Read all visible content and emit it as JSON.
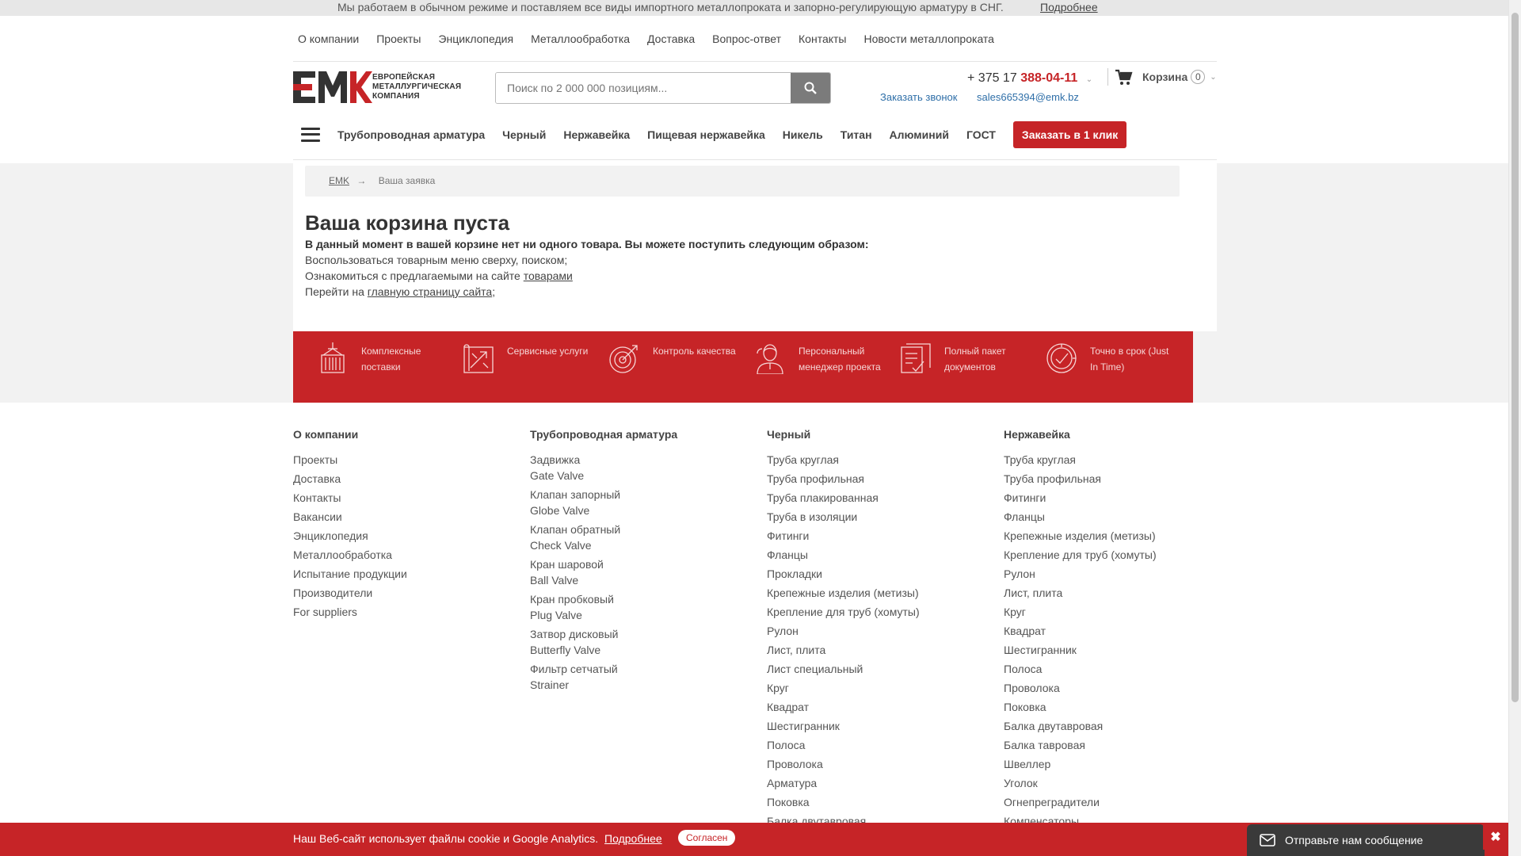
{
  "infobar": {
    "message": "Мы работаем в обычном режиме и поставляем все виды импортного металлопроката и запорно-регулирующую арматуру в СНГ.",
    "more": "Подробнее"
  },
  "topnav": [
    "О компании",
    "Проекты",
    "Энциклопедия",
    "Металлообработка",
    "Доставка",
    "Вопрос-ответ",
    "Контакты",
    "Новости металлопроката"
  ],
  "header": {
    "logo_text": "ЕВРОПЕЙСКАЯ МЕТАЛЛУРГИЧЕСКАЯ КОМПАНИЯ",
    "search_placeholder": "Поиск по 2 000 000 позициям...",
    "phone_prefix": "+ 375 17",
    "phone_main": "388-04-11",
    "callback": "Заказать звонок",
    "email": "sales665394@emk.bz",
    "cart_label": "Корзина",
    "cart_count": "0"
  },
  "catnav": {
    "items": [
      "Трубопроводная арматура",
      "Черный",
      "Нержавейка",
      "Пищевая нержавейка",
      "Никель",
      "Титан",
      "Алюминий",
      "ГОСТ"
    ],
    "order_button": "Заказать в 1 клик"
  },
  "breadcrumb": {
    "home": "EMK",
    "arrow": "→",
    "current": "Ваша заявка"
  },
  "cart_empty": {
    "title": "Ваша корзина пуста",
    "lead": "В данный момент в вашей корзине нет ни одного товара. Вы можете поступить следующим образом:",
    "line1": "Воспользоваться товарным меню сверху, поиском;",
    "line2_text": "Ознакомиться с предлагаемыми на сайте ",
    "line2_link": "товарами",
    "line3_text": "Перейти на ",
    "line3_link": "главную страницу сайта",
    "line3_end": ";"
  },
  "features": [
    {
      "icon": "container-icon",
      "text": "Комплексные поставки"
    },
    {
      "icon": "blueprint-icon",
      "text": "Сервисные услуги"
    },
    {
      "icon": "target-icon",
      "text": "Контроль качества"
    },
    {
      "icon": "manager-icon",
      "text": "Персональный менеджер проекта"
    },
    {
      "icon": "documents-icon",
      "text": "Полный пакет документов"
    },
    {
      "icon": "clock-check-icon",
      "text": "Точно в срок (Just In Time)"
    }
  ],
  "footer": {
    "col1": {
      "title": "О компании",
      "items": [
        "Проекты",
        "Доставка",
        "Контакты",
        "Вакансии",
        "Энциклопедия",
        "Металлообработка",
        "Испытание продукции",
        "Производители",
        "For suppliers"
      ]
    },
    "col2": {
      "title": "Трубопроводная арматура",
      "items": [
        {
          "ru": "Задвижка",
          "en": "Gate Valve"
        },
        {
          "ru": "Клапан запорный",
          "en": "Globe Valve"
        },
        {
          "ru": "Клапан обратный",
          "en": "Check Valve"
        },
        {
          "ru": "Кран шаровой",
          "en": "Ball Valve"
        },
        {
          "ru": "Кран пробковый",
          "en": "Plug Valve"
        },
        {
          "ru": "Затвор дисковый",
          "en": "Butterfly Valve"
        },
        {
          "ru": "Фильтр сетчатый",
          "en": "Strainer"
        }
      ]
    },
    "col3": {
      "title": "Черный",
      "items": [
        "Труба круглая",
        "Труба профильная",
        "Труба плакированная",
        "Труба в изоляции",
        "Фитинги",
        "Фланцы",
        "Прокладки",
        "Крепежные изделия (метизы)",
        "Крепление для труб (хомуты)",
        "Рулон",
        "Лист, плита",
        "Лист специальный",
        "Круг",
        "Квадрат",
        "Шестигранник",
        "Полоса",
        "Проволока",
        "Арматура",
        "Поковка",
        "Балка двутавровая"
      ]
    },
    "col4": {
      "title": "Нержавейка",
      "items": [
        "Труба круглая",
        "Труба профильная",
        "Фитинги",
        "Фланцы",
        "Крепежные изделия (метизы)",
        "Крепление для труб (хомуты)",
        "Рулон",
        "Лист, плита",
        "Круг",
        "Квадрат",
        "Шестигранник",
        "Полоса",
        "Проволока",
        "Поковка",
        "Балка двутавровая",
        "Балка тавровая",
        "Швеллер",
        "Уголок",
        "Огнепреградители",
        "Компенсаторы"
      ]
    }
  },
  "cookie": {
    "text": "Наш Веб-сайт использует файлы cookie и Google Analytics.",
    "more": "Подробнее",
    "ok": "Согласен"
  },
  "chat": {
    "label": "Отправьте нам сообщение",
    "close": "✖"
  },
  "colors": {
    "brand_red": "#c62427",
    "link_blue": "#2f6fa8"
  }
}
